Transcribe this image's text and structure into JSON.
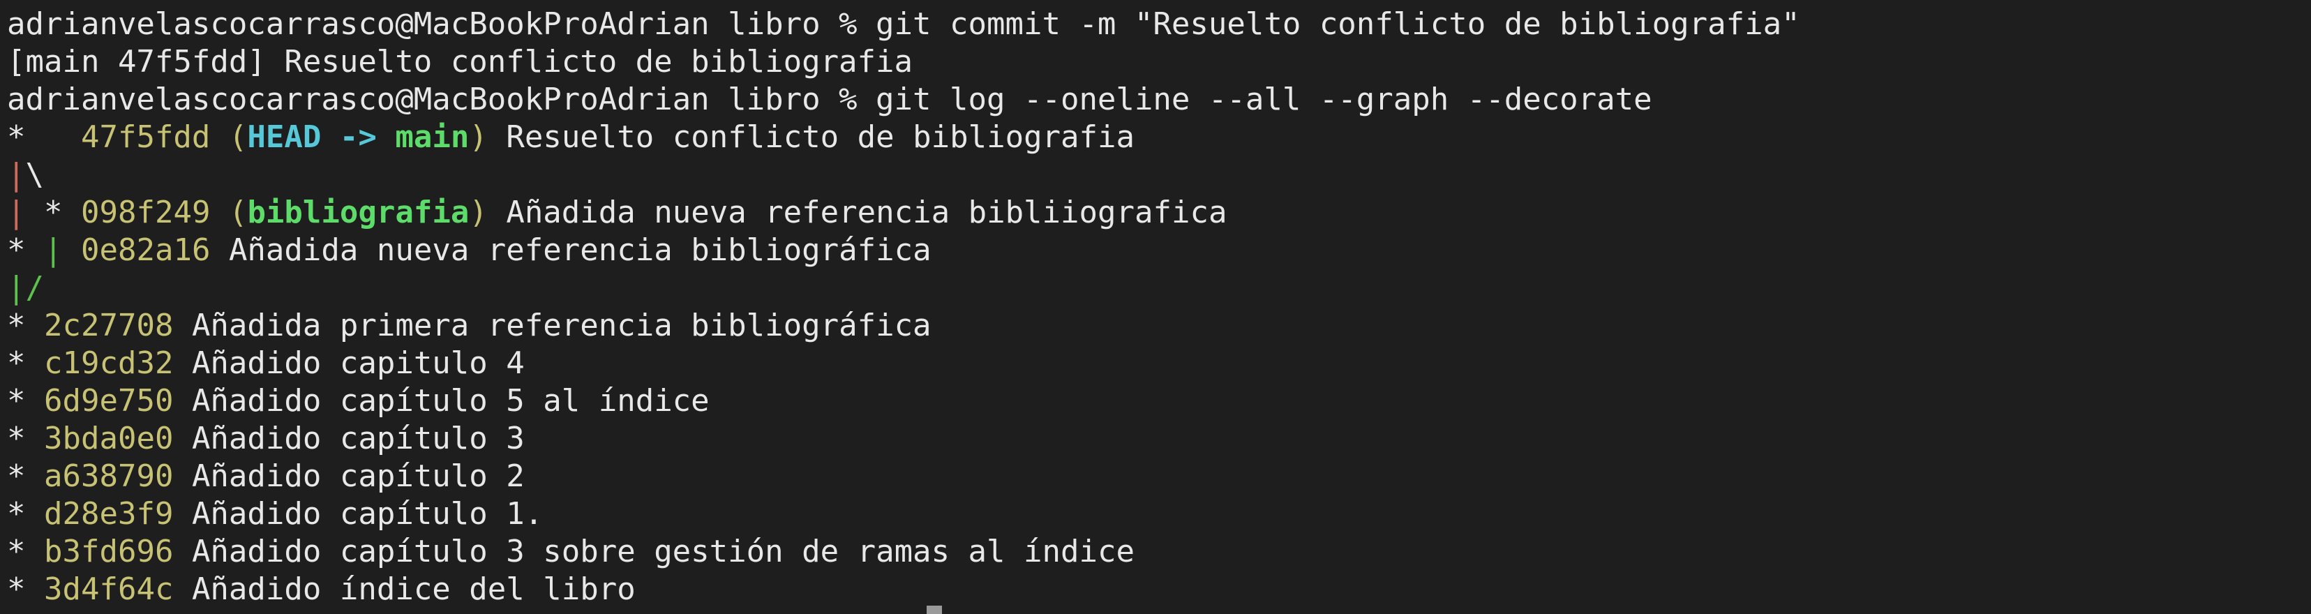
{
  "terminal": {
    "prompt": "adrianvelascocarrasco@MacBookProAdrian libro % ",
    "commands": {
      "commit": "git commit -m \"Resuelto conflicto de bibliografia\"",
      "log": "git log --oneline --all --graph --decorate"
    },
    "commit_output": "[main 47f5fdd] Resuelto conflicto de bibliografia",
    "graph": {
      "merge_line": "|\\",
      "branch_close_line": "|/",
      "pipe": "|",
      "star": "*"
    },
    "log_entries": [
      {
        "hash": "47f5fdd",
        "head_label": "HEAD",
        "arrow": "->",
        "branch": "main",
        "message": "Resuelto conflicto de bibliografia"
      },
      {
        "hash": "098f249",
        "branch": "bibliografia",
        "message": "Añadida nueva referencia bibliiografica"
      },
      {
        "hash": "0e82a16",
        "message": "Añadida nueva referencia bibliográfica"
      },
      {
        "hash": "2c27708",
        "message": "Añadida primera referencia bibliográfica"
      },
      {
        "hash": "c19cd32",
        "message": "Añadido capitulo 4"
      },
      {
        "hash": "6d9e750",
        "message": "Añadido capítulo 5 al índice"
      },
      {
        "hash": "3bda0e0",
        "message": "Añadido capítulo 3"
      },
      {
        "hash": "a638790",
        "message": "Añadido capítulo 2"
      },
      {
        "hash": "d28e3f9",
        "message": "Añadido capítulo 1."
      },
      {
        "hash": "b3fd696",
        "message": "Añadido capítulo 3 sobre gestión de ramas al índice"
      },
      {
        "hash": "3d4f64c",
        "message": "Añadido índice del libro"
      }
    ]
  },
  "colors": {
    "background": "#1e1e1e",
    "text": "#e8e8e8",
    "hash": "#c8c274",
    "head": "#56c8d8",
    "branch": "#5ddc6a",
    "graph_red": "#d06a5a",
    "graph_green": "#5ec04e"
  }
}
